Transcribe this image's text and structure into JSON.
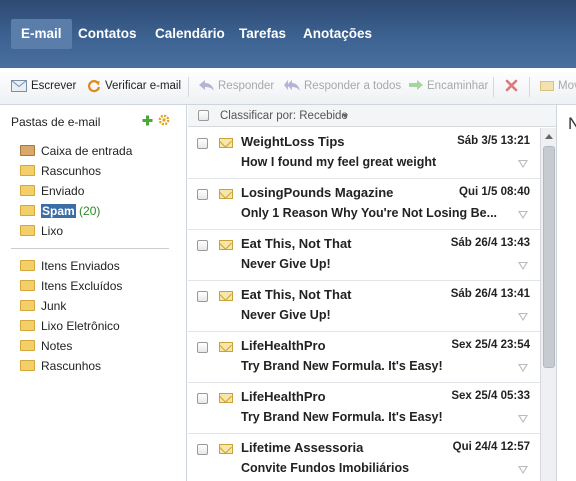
{
  "nav": {
    "tabs": [
      {
        "label": "E-mail",
        "active": true
      },
      {
        "label": "Contatos"
      },
      {
        "label": "Calendário"
      },
      {
        "label": "Tarefas"
      },
      {
        "label": "Anotações"
      }
    ]
  },
  "toolbar": {
    "compose": "Escrever",
    "check_mail": "Verificar e-mail",
    "reply": "Responder",
    "reply_all": "Responder a todos",
    "forward": "Encaminhar",
    "move": "Mov"
  },
  "sidebar": {
    "title": "Pastas de e-mail",
    "folders": [
      {
        "label": "Caixa de entrada",
        "icon": "inbox-icon"
      },
      {
        "label": "Rascunhos",
        "icon": "folder-icon"
      },
      {
        "label": "Enviado",
        "icon": "folder-icon"
      },
      {
        "label": "Spam",
        "count": "(20)",
        "selected": true,
        "icon": "folder-icon"
      },
      {
        "label": "Lixo",
        "icon": "folder-icon"
      }
    ],
    "custom_folders": [
      {
        "label": "Itens Enviados"
      },
      {
        "label": "Itens Excluídos"
      },
      {
        "label": "Junk"
      },
      {
        "label": "Lixo Eletrônico"
      },
      {
        "label": "Notes"
      },
      {
        "label": "Rascunhos"
      }
    ]
  },
  "list": {
    "sort_label": "Classificar por: Recebido",
    "messages": [
      {
        "sender": "WeightLoss Tips",
        "date": "Sáb 3/5 13:21",
        "subject": "How I found my feel great weight"
      },
      {
        "sender": "LosingPounds Magazine",
        "date": "Qui 1/5 08:40",
        "subject": "Only 1 Reason Why You're Not Losing Be..."
      },
      {
        "sender": "Eat This, Not That",
        "date": "Sáb 26/4 13:43",
        "subject": "Never Give Up!"
      },
      {
        "sender": "Eat This, Not That",
        "date": "Sáb 26/4 13:41",
        "subject": "Never Give Up!"
      },
      {
        "sender": "LifeHealthPro",
        "date": "Sex 25/4 23:54",
        "subject": "Try Brand New Formula. It's Easy!"
      },
      {
        "sender": "LifeHealthPro",
        "date": "Sex 25/4 05:33",
        "subject": "Try Brand New Formula. It's Easy!"
      },
      {
        "sender": "Lifetime Assessoria",
        "date": "Qui 24/4 12:57",
        "subject": "Convite Fundos Imobiliários"
      }
    ]
  },
  "reading_pane": {
    "title_fragment": "N"
  },
  "colors": {
    "nav_bg": "#3e6494",
    "selected_folder": "#3a6ea5",
    "count_green": "#2a8a2a"
  }
}
